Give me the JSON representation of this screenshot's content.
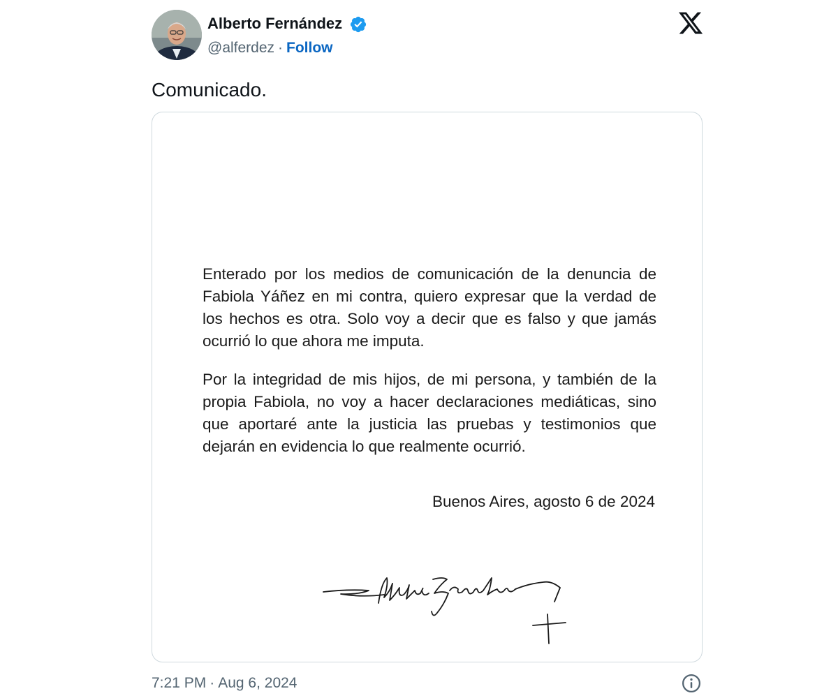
{
  "author": {
    "name": "Alberto Fernández",
    "handle": "@alferdez",
    "separator": "·",
    "follow_label": "Follow",
    "verified": true,
    "avatar_icon": "profile-photo",
    "verified_icon": "verified-badge-icon",
    "verified_color": "#1d9bf0"
  },
  "platform_icon": "x-logo-icon",
  "tweet": {
    "text": "Comunicado."
  },
  "letter": {
    "paragraph_1": "Enterado por los medios de comunicación de la denuncia de Fabiola Yáñez en mi contra, quiero expresar que la verdad de los hechos es otra. Solo voy a decir que es falso y que jamás ocurrió lo que ahora me imputa.",
    "paragraph_2": "Por la integridad de mis hijos, de mi persona, y también de la propia Fabiola, no voy a hacer declaraciones mediáticas, sino que aportaré  ante la justicia las pruebas y testimonios que dejarán en evidencia lo que realmente ocurrió.",
    "date_line": "Buenos Aires, agosto 6 de 2024",
    "signature_text": "Alberto Fernández"
  },
  "footer": {
    "time": "7:21 PM",
    "separator": "·",
    "date": "Aug 6, 2024",
    "info_icon": "info-icon"
  },
  "colors": {
    "text_primary": "#0f1419",
    "text_secondary": "#536471",
    "link": "#0a66c2",
    "card_border": "#cfd9de"
  }
}
